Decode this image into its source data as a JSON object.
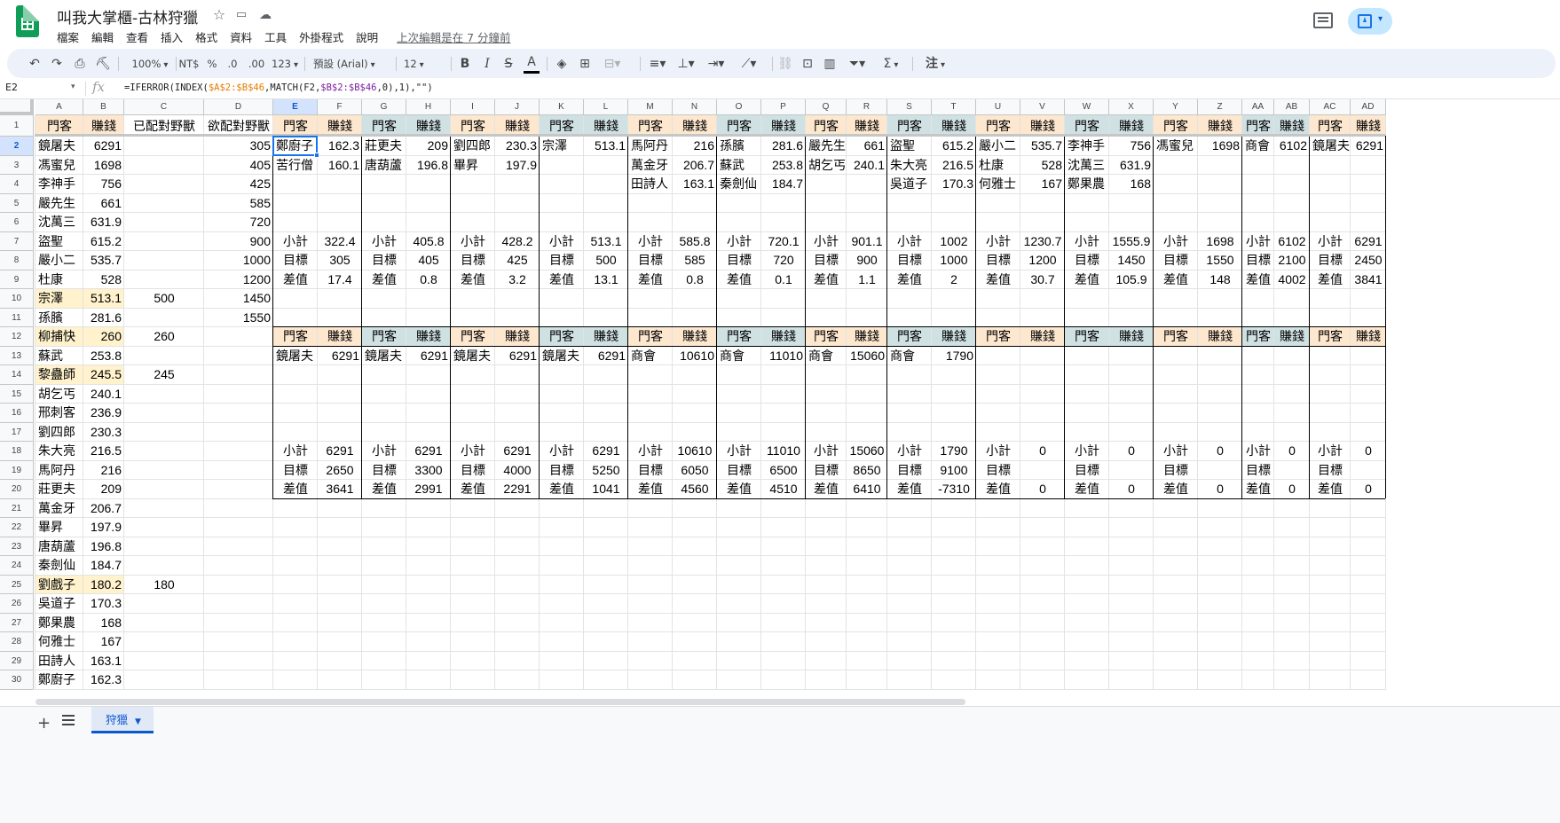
{
  "app": {
    "title": "叫我大掌櫃-古林狩獵",
    "last_edit": "上次編輯是在 7 分鐘前",
    "menu": [
      "檔案",
      "編輯",
      "查看",
      "插入",
      "格式",
      "資料",
      "工具",
      "外掛程式",
      "說明"
    ]
  },
  "toolbar": {
    "zoom": "100%",
    "currency": "NT$",
    "percent": "%",
    "dec_decrease": ".0",
    "dec_increase": ".00",
    "more_formats": "123",
    "font": "預設 (Arial)",
    "font_size": "12",
    "bold": "B",
    "italic": "I",
    "strike": "S",
    "text_color": "A",
    "sum": "Σ",
    "comment": "注"
  },
  "formula_bar": {
    "cell_ref": "E2",
    "fx": "fx",
    "formula_prefix": "=IFERROR(INDEX(",
    "formula_ref1": "$A$2:$B$46",
    "formula_mid": ",MATCH(F2,",
    "formula_ref2": "$B$2:$B$46",
    "formula_suffix": ",0),1),\"\")"
  },
  "sheet": {
    "tab_name": "狩獵",
    "columns": [
      "A",
      "B",
      "C",
      "D",
      "E",
      "F",
      "G",
      "H",
      "I",
      "J",
      "K",
      "L",
      "M",
      "N",
      "O",
      "P",
      "Q",
      "R",
      "S",
      "T",
      "U",
      "V",
      "W",
      "X",
      "Y",
      "Z",
      "AA",
      "AB",
      "AC",
      "AD"
    ],
    "rows": [
      1,
      2,
      3,
      4,
      5,
      6,
      7,
      8,
      9,
      10,
      11,
      12,
      13,
      14,
      15,
      16,
      17,
      18,
      19,
      20,
      21,
      22,
      23,
      24,
      25,
      26,
      27,
      28,
      29,
      30
    ],
    "header_row1": [
      "門客",
      "賺錢",
      "已配對野獸",
      "欲配對野獸",
      "門客",
      "賺錢",
      "門客",
      "賺錢",
      "門客",
      "賺錢",
      "門客",
      "賺錢",
      "門客",
      "賺錢",
      "門客",
      "賺錢",
      "門客",
      "賺錢",
      "門客",
      "賺錢",
      "門客",
      "賺錢",
      "門客",
      "賺錢",
      "門客",
      "賺錢",
      "門客",
      "賺錢",
      "門客",
      "賺錢"
    ],
    "list_a": [
      "鏡屠夫",
      "馮蜜兒",
      "李神手",
      "嚴先生",
      "沈萬三",
      "盜聖",
      "嚴小二",
      "杜康",
      "宗澤",
      "孫臏",
      "柳捕快",
      "蘇武",
      "黎蠱師",
      "胡乞丐",
      "邢刺客",
      "劉四郎",
      "朱大亮",
      "馬阿丹",
      "莊更夫",
      "萬金牙",
      "畢昇",
      "唐葫蘆",
      "秦劍仙",
      "劉戲子",
      "吳道子",
      "鄭果農",
      "何雅士",
      "田詩人",
      "鄭廚子"
    ],
    "list_b": [
      "6291",
      "1698",
      "756",
      "661",
      "631.9",
      "615.2",
      "535.7",
      "528",
      "513.1",
      "281.6",
      "260",
      "253.8",
      "245.5",
      "240.1",
      "236.9",
      "230.3",
      "216.5",
      "216",
      "209",
      "206.7",
      "197.9",
      "196.8",
      "184.7",
      "180.2",
      "170.3",
      "168",
      "167",
      "163.1",
      "162.3"
    ],
    "col_c": {
      "10": "500",
      "12": "260",
      "14": "245",
      "25": "180"
    },
    "col_d": [
      "305",
      "405",
      "425",
      "585",
      "720",
      "900",
      "1000",
      "1200",
      "1450",
      "1550"
    ],
    "sub_label": "小計",
    "target_label": "目標",
    "diff_label": "差值",
    "block1": [
      {
        "members": [
          [
            "鄭廚子",
            "162.3"
          ],
          [
            "苦行僧",
            "160.1"
          ]
        ],
        "sub": "322.4",
        "target": "305",
        "diff": "17.4"
      },
      {
        "members": [
          [
            "莊更夫",
            "209"
          ],
          [
            "唐葫蘆",
            "196.8"
          ]
        ],
        "sub": "405.8",
        "target": "405",
        "diff": "0.8"
      },
      {
        "members": [
          [
            "劉四郎",
            "230.3"
          ],
          [
            "畢昇",
            "197.9"
          ]
        ],
        "sub": "428.2",
        "target": "425",
        "diff": "3.2"
      },
      {
        "members": [
          [
            "宗澤",
            "513.1"
          ]
        ],
        "sub": "513.1",
        "target": "500",
        "diff": "13.1"
      },
      {
        "members": [
          [
            "馬阿丹",
            "216"
          ],
          [
            "萬金牙",
            "206.7"
          ],
          [
            "田詩人",
            "163.1"
          ]
        ],
        "sub": "585.8",
        "target": "585",
        "diff": "0.8"
      },
      {
        "members": [
          [
            "孫臏",
            "281.6"
          ],
          [
            "蘇武",
            "253.8"
          ],
          [
            "秦劍仙",
            "184.7"
          ]
        ],
        "sub": "720.1",
        "target": "720",
        "diff": "0.1"
      },
      {
        "members": [
          [
            "嚴先生",
            "661"
          ],
          [
            "胡乞丐",
            "240.1"
          ]
        ],
        "sub": "901.1",
        "target": "900",
        "diff": "1.1"
      },
      {
        "members": [
          [
            "盜聖",
            "615.2"
          ],
          [
            "朱大亮",
            "216.5"
          ],
          [
            "吳道子",
            "170.3"
          ]
        ],
        "sub": "1002",
        "target": "1000",
        "diff": "2"
      },
      {
        "members": [
          [
            "嚴小二",
            "535.7"
          ],
          [
            "杜康",
            "528"
          ],
          [
            "何雅士",
            "167"
          ]
        ],
        "sub": "1230.7",
        "target": "1200",
        "diff": "30.7"
      },
      {
        "members": [
          [
            "李神手",
            "756"
          ],
          [
            "沈萬三",
            "631.9"
          ],
          [
            "鄭果農",
            "168"
          ]
        ],
        "sub": "1555.9",
        "target": "1450",
        "diff": "105.9"
      },
      {
        "members": [
          [
            "馮蜜兒",
            "1698"
          ]
        ],
        "sub": "1698",
        "target": "1550",
        "diff": "148"
      },
      {
        "members": [
          [
            "商會",
            "6102"
          ]
        ],
        "sub": "6102",
        "target": "2100",
        "diff": "4002"
      },
      {
        "members": [
          [
            "鏡屠夫",
            "6291"
          ]
        ],
        "sub": "6291",
        "target": "2450",
        "diff": "3841"
      }
    ],
    "block2": [
      {
        "members": [
          [
            "鏡屠夫",
            "6291"
          ]
        ],
        "sub": "6291",
        "target": "2650",
        "diff": "3641"
      },
      {
        "members": [
          [
            "鏡屠夫",
            "6291"
          ]
        ],
        "sub": "6291",
        "target": "3300",
        "diff": "2991"
      },
      {
        "members": [
          [
            "鏡屠夫",
            "6291"
          ]
        ],
        "sub": "6291",
        "target": "4000",
        "diff": "2291"
      },
      {
        "members": [
          [
            "鏡屠夫",
            "6291"
          ]
        ],
        "sub": "6291",
        "target": "5250",
        "diff": "1041"
      },
      {
        "members": [
          [
            "商會",
            "10610"
          ]
        ],
        "sub": "10610",
        "target": "6050",
        "diff": "4560"
      },
      {
        "members": [
          [
            "商會",
            "11010"
          ]
        ],
        "sub": "11010",
        "target": "6500",
        "diff": "4510"
      },
      {
        "members": [
          [
            "商會",
            "15060"
          ]
        ],
        "sub": "15060",
        "target": "8650",
        "diff": "6410"
      },
      {
        "members": [
          [
            "商會",
            "1790"
          ]
        ],
        "sub": "1790",
        "target": "9100",
        "diff": "-7310"
      },
      {
        "members": [],
        "sub": "0",
        "target": "",
        "diff": "0"
      },
      {
        "members": [],
        "sub": "0",
        "target": "",
        "diff": "0"
      },
      {
        "members": [],
        "sub": "0",
        "target": "",
        "diff": "0"
      },
      {
        "members": [],
        "sub": "0",
        "target": "",
        "diff": "0"
      },
      {
        "members": [],
        "sub": "0",
        "target": "",
        "diff": "0"
      }
    ]
  },
  "colors": {
    "header_peach": "#fde7cf",
    "header_blue": "#d0e1e3",
    "highlight_yellow": "#fff2cc",
    "selection": "#1a73e8",
    "header_selected": "#d3e3fd"
  }
}
